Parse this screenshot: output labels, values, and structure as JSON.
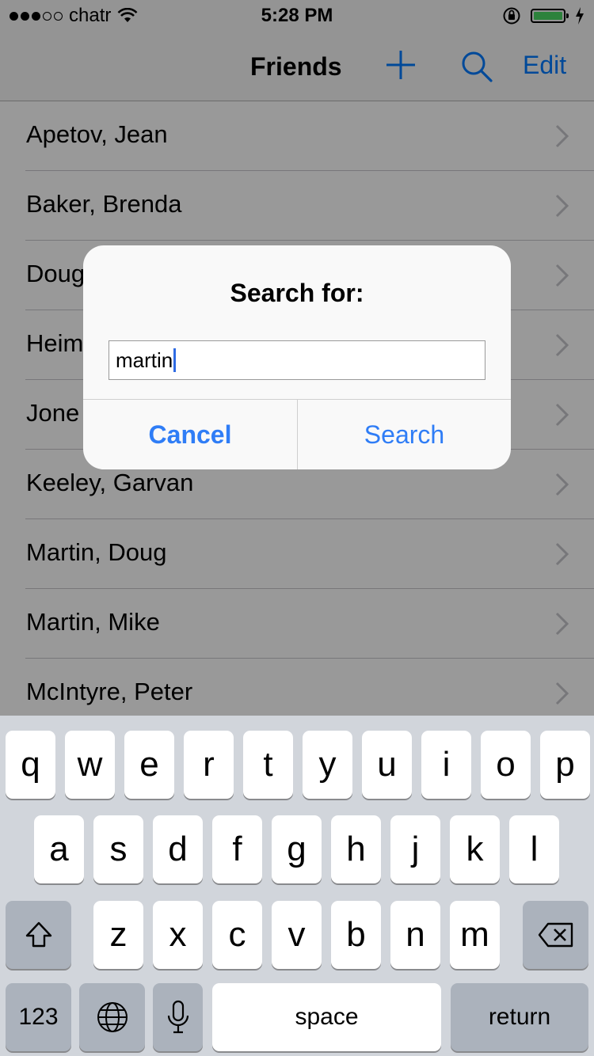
{
  "status_bar": {
    "carrier": "chatr",
    "time": "5:28 PM",
    "signal_filled": 3,
    "signal_total": 5,
    "battery_level": 1.0
  },
  "nav": {
    "title": "Friends",
    "edit_label": "Edit"
  },
  "friends": [
    "Apetov, Jean",
    "Baker, Brenda",
    "Doug",
    "Heim",
    "Jone",
    "Keeley, Garvan",
    "Martin, Doug",
    "Martin, Mike",
    "McIntyre, Peter"
  ],
  "alert": {
    "title": "Search for:",
    "input_value": "martin",
    "cancel_label": "Cancel",
    "search_label": "Search"
  },
  "keyboard": {
    "row1": [
      "q",
      "w",
      "e",
      "r",
      "t",
      "y",
      "u",
      "i",
      "o",
      "p"
    ],
    "row2": [
      "a",
      "s",
      "d",
      "f",
      "g",
      "h",
      "j",
      "k",
      "l"
    ],
    "row3": [
      "z",
      "x",
      "c",
      "v",
      "b",
      "n",
      "m"
    ],
    "numbers_label": "123",
    "space_label": "space",
    "return_label": "return"
  },
  "colors": {
    "accent": "#2f7df6",
    "battery": "#4cd964",
    "keyboard_bg": "#d1d5db"
  }
}
